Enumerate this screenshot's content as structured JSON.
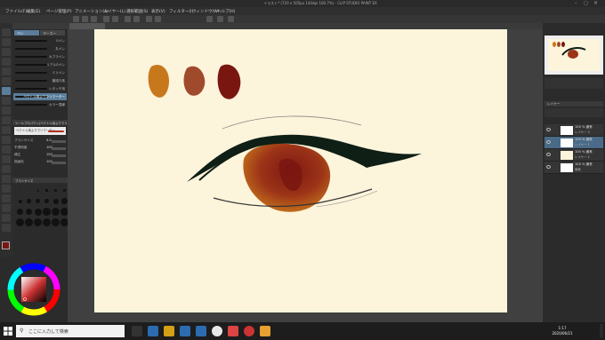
{
  "window": {
    "title": "イラスト* (720 x 505px 144dpi 100.7%) - CLIP STUDIO PAINT EX"
  },
  "menu": [
    "ファイル(F)",
    "編集(E)",
    "ページ管理(P)",
    "アニメーション(A)",
    "レイヤー(L)",
    "選択範囲(S)",
    "表示(V)",
    "フィルター(I)",
    "ウィンドウ(W)",
    "ヘルプ(H)"
  ],
  "subtool": {
    "header_tab_active": "ペン",
    "header_tab_2": "マーカー",
    "brushes": [
      {
        "label": "Gペン"
      },
      {
        "label": "丸ペン"
      },
      {
        "label": "カブラペン"
      },
      {
        "label": "リアルGペン"
      },
      {
        "label": "ミリペン"
      },
      {
        "label": "筆描き風"
      },
      {
        "label": "レタッチ用"
      },
      {
        "label": "ベクトル用よりでリマーター"
      },
      {
        "label": "カラー混線"
      }
    ]
  },
  "tool_property": {
    "header": "ツールプロパティ[ベクトル用よりでリマーター]",
    "preview_label": "ベクトル用よりでリマーター",
    "rows": [
      {
        "label": "ブラシサイズ",
        "value": "4.0"
      },
      {
        "label": "不透明度",
        "value": "100"
      },
      {
        "label": "補正",
        "value": "100"
      },
      {
        "label": "描画色",
        "value": "100"
      }
    ]
  },
  "brush_size_panel": {
    "header": "ブラシサイズ"
  },
  "layers": {
    "header": "レイヤー",
    "items": [
      {
        "name": "100 % 通常",
        "sub": "レイヤー 3"
      },
      {
        "name": "100 % 通常",
        "sub": "レイヤー 1"
      },
      {
        "name": "100 % 通常",
        "sub": "レイヤー 2"
      },
      {
        "name": "100 % 通常",
        "sub": "用紙"
      },
      {
        "name": "",
        "sub": ""
      }
    ]
  },
  "taskbar": {
    "search_placeholder": "ここに入力して検索",
    "time": "1:17",
    "date": "2020/06/21"
  },
  "colors": {
    "canvas_bg": "#fdf4dc",
    "swatch_1": "#c8781c",
    "swatch_2": "#a04a2c",
    "swatch_3": "#7a1610",
    "accent": "#5a7e9c"
  },
  "icons": {
    "color_wheel": "color-wheel-icon",
    "windows_start": "windows-logo-icon"
  }
}
